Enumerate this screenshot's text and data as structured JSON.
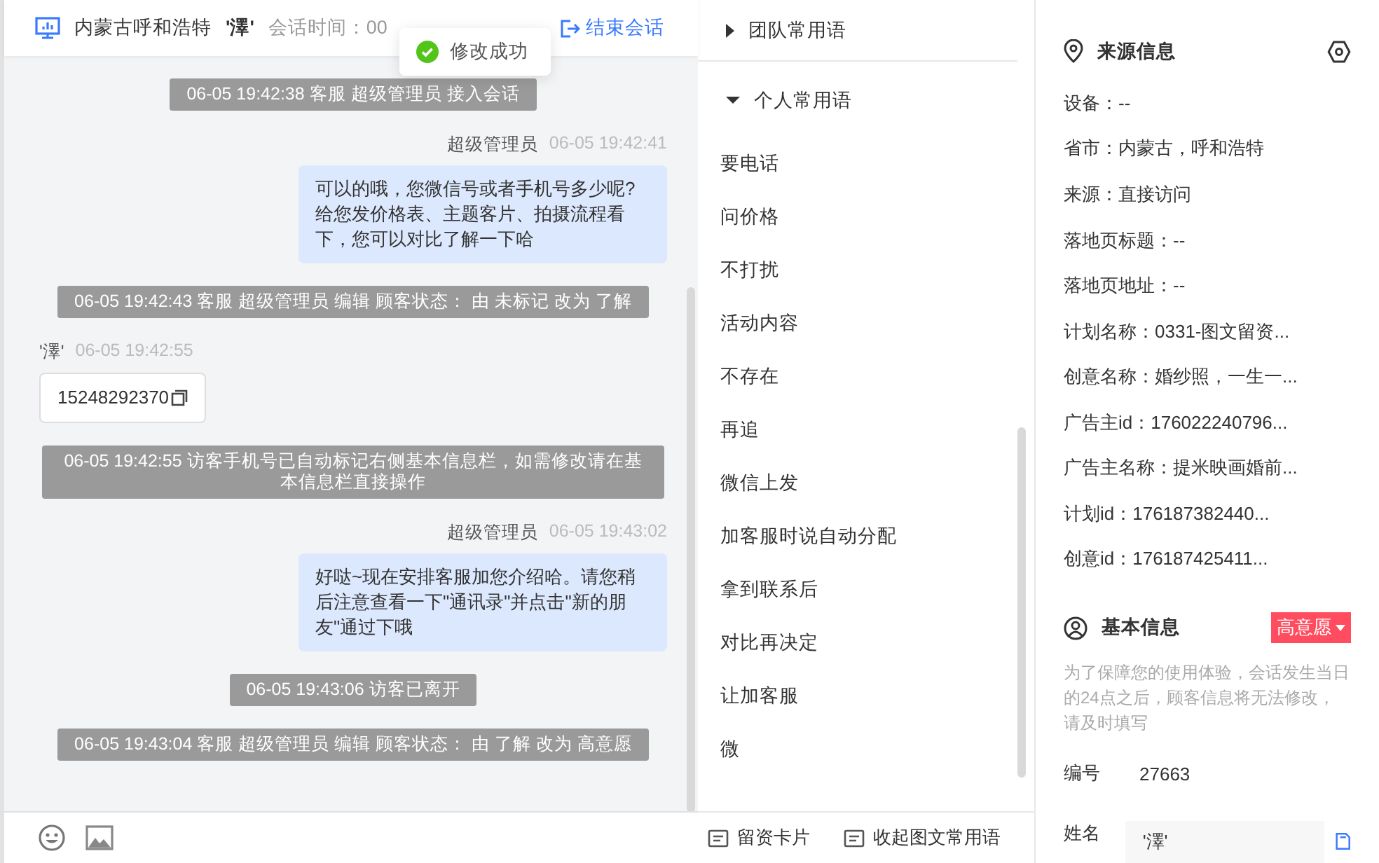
{
  "header": {
    "location": "内蒙古呼和浩特",
    "visitor": "'澤'",
    "session_time": "会话时间：00",
    "end_button": "结束会话"
  },
  "toast": {
    "text": "修改成功"
  },
  "messages": [
    {
      "kind": "system",
      "text": "06-05 19:42:38 客服 超级管理员 接入会话"
    },
    {
      "kind": "agent",
      "sender": "超级管理员",
      "time": "06-05 19:42:41",
      "text": "可以的哦，您微信号或者手机号多少呢?给您发价格表、主题客片、拍摄流程看下，您可以对比了解一下哈"
    },
    {
      "kind": "system",
      "text": "06-05 19:42:43 客服 超级管理员 编辑 顾客状态： 由 未标记 改为 了解"
    },
    {
      "kind": "visitor",
      "sender": "'澤'",
      "time": "06-05 19:42:55",
      "text": "15248292370"
    },
    {
      "kind": "system",
      "text": "06-05 19:42:55 访客手机号已自动标记右侧基本信息栏，如需修改请在基本信息栏直接操作"
    },
    {
      "kind": "agent",
      "sender": "超级管理员",
      "time": "06-05 19:43:02",
      "text": "好哒~现在安排客服加您介绍哈。请您稍后注意查看一下\"通讯录\"并点击\"新的朋友\"通过下哦"
    },
    {
      "kind": "system",
      "text": "06-05 19:43:06 访客已离开"
    },
    {
      "kind": "system",
      "text": "06-05 19:43:04 客服 超级管理员 编辑 顾客状态： 由 了解 改为 高意愿"
    }
  ],
  "phrase_groups": [
    {
      "label": "团队常用语",
      "expanded": false
    },
    {
      "label": "个人常用语",
      "expanded": true,
      "items": [
        "要电话",
        "问价格",
        "不打扰",
        "活动内容",
        "不存在",
        "再追",
        "微信上发",
        "加客服时说自动分配",
        "拿到联系后",
        "对比再决定",
        "让加客服",
        "微"
      ]
    }
  ],
  "phrase_footer": [
    "留资卡片",
    "收起图文常用语"
  ],
  "source_info": {
    "title": "来源信息",
    "fields": [
      "设备：--",
      "省市：内蒙古，呼和浩特",
      "来源：直接访问",
      "落地页标题：--",
      "落地页地址：--",
      "计划名称：0331-图文留资...",
      "创意名称：婚纱照，一生一...",
      "广告主id：176022240796...",
      "广告主名称：提米映画婚前...",
      "计划id：176187382440...",
      "创意id：176187425411..."
    ]
  },
  "basic_info": {
    "title": "基本信息",
    "status": "高意愿",
    "note": "为了保障您的使用体验，会话发生当日的24点之后，顾客信息将无法修改，请及时填写",
    "fields": [
      {
        "kind": "text",
        "label": "编号",
        "value": "27663"
      },
      {
        "kind": "input",
        "label": "姓名",
        "value": "'澤'"
      }
    ]
  }
}
